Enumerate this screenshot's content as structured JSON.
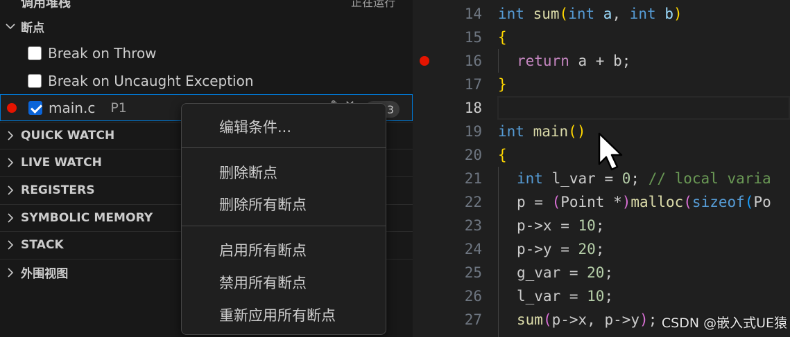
{
  "left_panel": {
    "header_cut_title": "调用堆栈",
    "header_cut_status": "正在运行",
    "breakpoints_section": "断点",
    "exception_items": [
      {
        "label": "Break on Throw",
        "checked": false
      },
      {
        "label": "Break on Uncaught Exception",
        "checked": false
      }
    ],
    "bp_main": {
      "file": "main.c",
      "line_label": "P1",
      "count": "3",
      "checked": true
    },
    "sections": [
      "QUICK WATCH",
      "LIVE WATCH",
      "REGISTERS",
      "SYMBOLIC MEMORY",
      "STACK",
      "外围视图"
    ]
  },
  "context_menu": {
    "items": [
      "编辑条件...",
      "删除断点",
      "删除所有断点",
      "启用所有断点",
      "禁用所有断点",
      "重新应用所有断点"
    ]
  },
  "editor": {
    "line_numbers": [
      "14",
      "15",
      "16",
      "17",
      "18",
      "19",
      "20",
      "21",
      "22",
      "23",
      "24",
      "25",
      "26",
      "27"
    ],
    "lines": [
      "int sum(int a, int b)",
      "{",
      "return a + b;",
      "}",
      "",
      "int main()",
      "{",
      "int l_var = 0; // local varia",
      "p = (Point *)malloc(sizeof(Po",
      "p->x = 10;",
      "p->y = 20;",
      "g_var = 20;",
      "l_var = 10;",
      "sum(p->x, p->y);"
    ],
    "breakpoint_line": "16",
    "current_line": "18"
  },
  "watermark": "CSDN @嵌入式UE猿",
  "colors": {
    "accent": "#0078d4",
    "breakpoint": "#e51400"
  }
}
